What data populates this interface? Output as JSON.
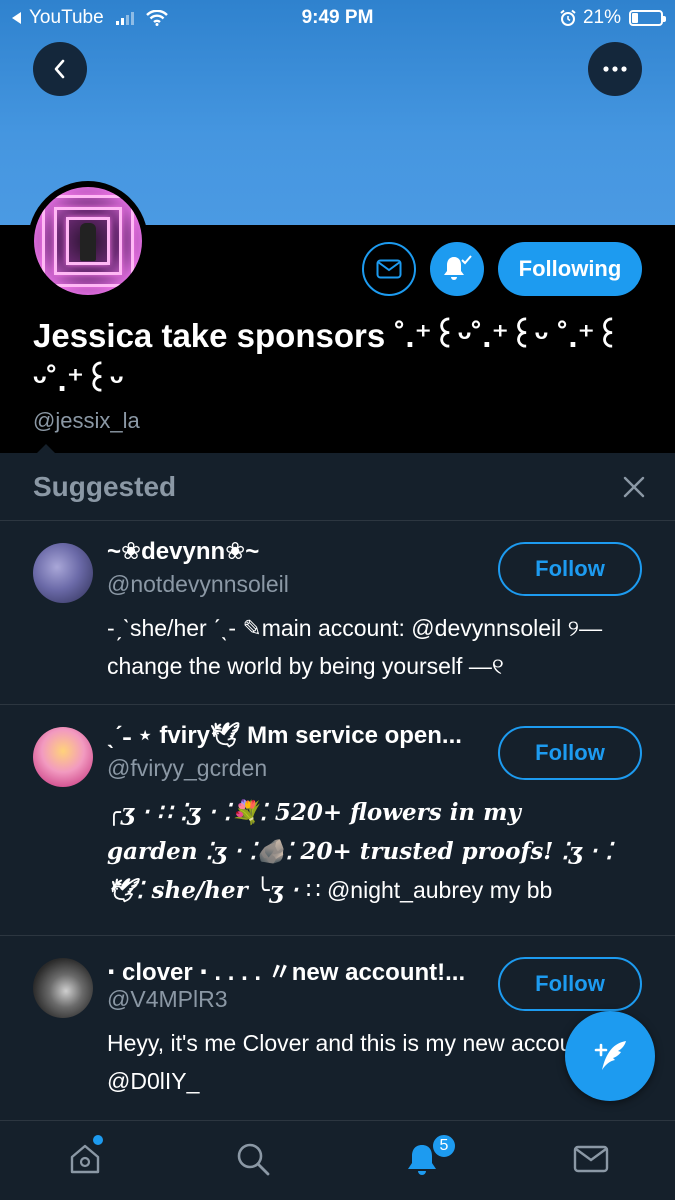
{
  "status_bar": {
    "back_app": "YouTube",
    "time": "9:49 PM",
    "battery": "21%"
  },
  "profile": {
    "display_name": "Jessica take sponsors ˚.⁺꒰ᵕ˚.⁺꒰ᵕ ˚.⁺꒰ᵕ˚.⁺꒰ᵕ",
    "handle": "@jessix_la",
    "following_label": "Following"
  },
  "suggested": {
    "title": "Suggested",
    "follow_label": "Follow",
    "accounts": [
      {
        "name": "~❀devynn❀~",
        "handle": "@notdevynnsoleil",
        "bio": "-ˏˋshe/her ˊˎ- ✎main account: @devynnsoleil ୨— change the world by being yourself —୧"
      },
      {
        "name": "ˎˊ˗ ⋆ fviry🕊 Mm service open...",
        "handle": "@fviryy_gcrden",
        "bio_line1": "╭ʒ ‧ ∷ ⁚ʒ ‧ ⁚💐⁚ 520+ flowers in my",
        "bio_line2": "garden ⁚ʒ ‧ ⁚🪨⁚ 20+ trusted proofs! ⁚ʒ ‧ ⁚",
        "bio_line3_fancy": "🕊⁚ she/her ╰ʒ ‧ ",
        "bio_line3_plain": "∷ @night_aubrey my bb"
      },
      {
        "name": " ‧ clover ‧ . . . . 〃new account!...",
        "handle": "@V4MPlR3",
        "bio": "Heyy, it's me Clover and this is my new account! B: @D0lIY_"
      }
    ]
  },
  "tabbar": {
    "notification_count": "5"
  },
  "colors": {
    "accent": "#1d9bf0",
    "banner": "#4b9ae3",
    "panel": "#15202b",
    "muted_text": "#8b98a5"
  },
  "icons": [
    "back-arrow-icon",
    "more-icon",
    "mail-icon",
    "bell-check-icon",
    "close-icon",
    "compose-icon",
    "home-icon",
    "search-icon",
    "notifications-icon",
    "messages-icon"
  ]
}
